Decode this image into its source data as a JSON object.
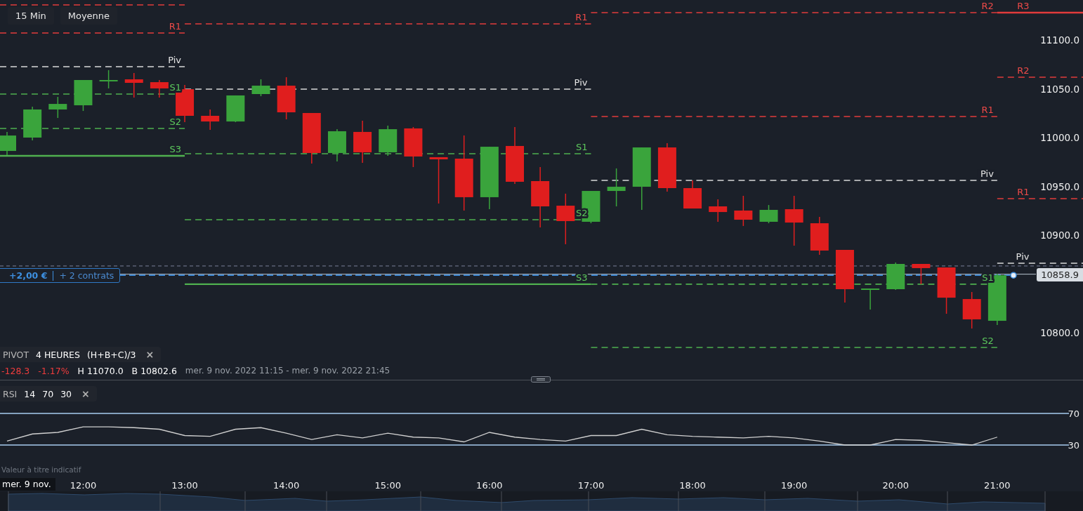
{
  "toolbar": {
    "buttons": [
      {
        "label": "15 Min"
      },
      {
        "label": "Moyenne"
      }
    ]
  },
  "price_chart": {
    "pivot_periods": [
      {
        "labels": [
          {
            "text": "R1",
            "kind": "resistance"
          },
          {
            "text": "Piv",
            "kind": "pivot"
          },
          {
            "text": "S1",
            "kind": "support"
          },
          {
            "text": "S2",
            "kind": "support"
          },
          {
            "text": "S3",
            "kind": "support"
          }
        ]
      },
      {
        "labels": [
          {
            "text": "R1",
            "kind": "resistance"
          },
          {
            "text": "Piv",
            "kind": "pivot"
          },
          {
            "text": "S1",
            "kind": "support"
          },
          {
            "text": "S2",
            "kind": "support"
          },
          {
            "text": "S3",
            "kind": "support"
          }
        ]
      },
      {
        "labels": [
          {
            "text": "R2",
            "kind": "resistance"
          },
          {
            "text": "R1",
            "kind": "resistance"
          },
          {
            "text": "Piv",
            "kind": "pivot"
          },
          {
            "text": "S1",
            "kind": "support"
          },
          {
            "text": "S2",
            "kind": "support"
          }
        ]
      },
      {
        "labels": [
          {
            "text": "R3",
            "kind": "resistance"
          },
          {
            "text": "R2",
            "kind": "resistance"
          },
          {
            "text": "R1",
            "kind": "resistance"
          },
          {
            "text": "Piv",
            "kind": "pivot"
          }
        ]
      }
    ],
    "price_labels": [
      "11100.0",
      "11050.0",
      "11000.0",
      "10950.0",
      "10900.0",
      "10800.0"
    ],
    "time_labels": [
      "12:00",
      "13:00",
      "14:00",
      "15:00",
      "16:00",
      "17:00",
      "18:00",
      "19:00",
      "20:00",
      "21:00"
    ]
  },
  "price_tag": "10858.9",
  "position": {
    "pnl": "+2,00 €",
    "contracts": "+ 2 contrats"
  },
  "pivot_legend": {
    "name": "PIVOT",
    "params": [
      "4 HEURES",
      "(H+B+C)/3"
    ],
    "close_icon": "×"
  },
  "ohlc_info": {
    "change": "-128.3",
    "change_pct": "-1.17%",
    "high": "H 11070.0",
    "low": "B 10802.6",
    "range": "mer. 9 nov. 2022 11:15 - mer. 9 nov. 2022 21:45"
  },
  "rsi_legend": {
    "name": "RSI",
    "params": [
      "14",
      "70",
      "30"
    ],
    "close_icon": "×"
  },
  "rsi_chart": {
    "chart_data": {
      "type": "line",
      "ylim": [
        30,
        70
      ],
      "yticks": [
        30,
        70
      ],
      "series": [
        {
          "color": "#d0d0d0",
          "values": [
            35,
            44,
            46,
            53,
            53,
            52,
            50,
            42,
            41,
            50,
            52,
            45,
            37,
            43,
            39,
            45,
            40,
            39,
            34,
            46,
            40,
            37,
            35,
            42,
            42,
            50,
            43,
            41,
            40,
            39,
            41,
            39,
            35,
            30,
            30,
            37,
            36,
            33,
            30,
            40
          ]
        }
      ]
    }
  },
  "disclaimer": "Valeur à titre indicatif",
  "time_axis": {
    "date": "mer. 9 nov."
  }
}
